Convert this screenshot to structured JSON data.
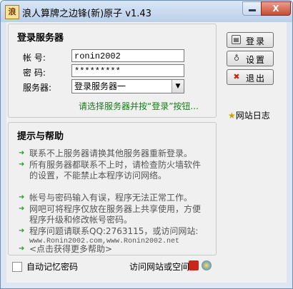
{
  "window": {
    "title": "浪人算牌之边锋(新)原子 v1.43",
    "app_icon_glyph": "浪"
  },
  "controls": {
    "minimize_label": "",
    "close_label": "X"
  },
  "login": {
    "group_title": "登录服务器",
    "account_label": "帐    号:",
    "account_value": "ronin2002",
    "password_label": "密    码:",
    "password_value": "*********",
    "server_label": "服务器:",
    "server_value": "登录服务器一",
    "hint": "请选择服务器并按“登录”按钮..."
  },
  "side_buttons": {
    "login": "登录",
    "settings": "设置",
    "exit": "退出",
    "website_log": "网站日志"
  },
  "help": {
    "group_title": "提示与帮助",
    "items": [
      "联系不上服务器请换其他服务器重新登录。",
      "所有服务器都联系不上时，请检查防火墙软件的设置，不能禁止本程序访问网络。",
      "帐号与密码输入有误，程序无法正常工作。",
      "网吧可将程序仅放在服务器上共享使用，方便程序升级和修改帐号密码。",
      "程序问题请联系QQ:2763115，或访问网站:",
      "<点击获得更多帮助>"
    ],
    "url_line": "www.Ronin2002.com,www.Ronin2002.net"
  },
  "footer": {
    "remember_password": "自动记忆密码",
    "visit_website": "访问网站或空间"
  },
  "colors": {
    "accent_green": "#1a7a1a",
    "bullet_green": "#2e9a2e",
    "titlebar": "#bcd0ea"
  }
}
